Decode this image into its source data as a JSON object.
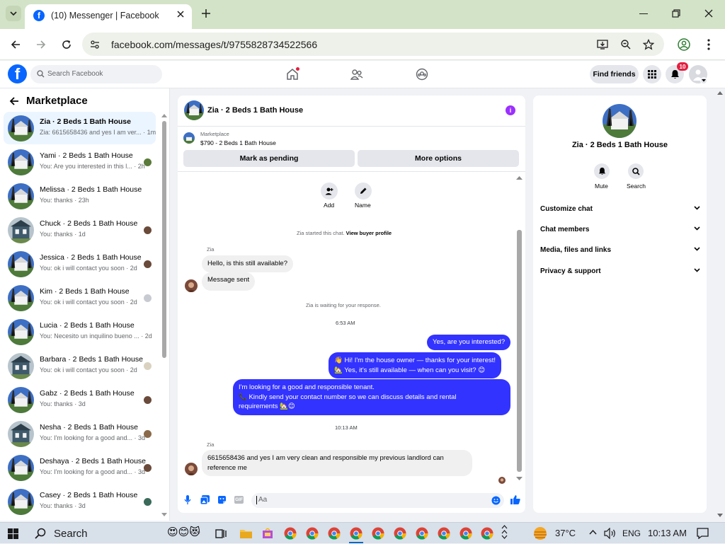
{
  "browser": {
    "tab_title": "(10) Messenger | Facebook",
    "url": "facebook.com/messages/t/9755828734522566"
  },
  "header": {
    "search_placeholder": "Search Facebook",
    "find_friends": "Find friends",
    "notif_count": "10"
  },
  "sidebar": {
    "title": "Marketplace",
    "conversations": [
      {
        "name": "Zia · 2 Beds 1 Bath House",
        "preview": "Zia: 6615658436 and yes I am ver...",
        "time": "· 1m"
      },
      {
        "name": "Yami · 2 Beds 1 Bath House",
        "preview": "You: Are you interested in this l...",
        "time": "· 2h"
      },
      {
        "name": "Melissa · 2 Beds 1 Bath House",
        "preview": "You: thanks",
        "time": "· 23h"
      },
      {
        "name": "Chuck · 2 Beds 1 Bath House",
        "preview": "You: thanks",
        "time": "· 1d"
      },
      {
        "name": "Jessica · 2 Beds 1 Bath House",
        "preview": "You: ok i will contact you soon",
        "time": "· 2d"
      },
      {
        "name": "Kim · 2 Beds 1 Bath House",
        "preview": "You: ok i will contact you soon",
        "time": "· 2d"
      },
      {
        "name": "Lucia · 2 Beds 1 Bath House",
        "preview": "You: Necesito un inquilino bueno ...",
        "time": "· 2d"
      },
      {
        "name": "Barbara · 2 Beds 1 Bath House",
        "preview": "You: ok i will contact you soon",
        "time": "· 2d"
      },
      {
        "name": "Gabz · 2 Beds 1 Bath House",
        "preview": "You: thanks",
        "time": "· 3d"
      },
      {
        "name": "Nesha · 2 Beds 1 Bath House",
        "preview": "You: I'm looking for a good and...",
        "time": "· 3d"
      },
      {
        "name": "Deshaya · 2 Beds 1 Bath House",
        "preview": "You: I'm looking for a good and...",
        "time": "· 3d"
      },
      {
        "name": "Casey · 2 Beds 1 Bath House",
        "preview": "You: thanks",
        "time": "· 3d"
      }
    ]
  },
  "chat": {
    "title": "Zia · 2 Beds 1 Bath House",
    "listing_label": "Marketplace",
    "listing_text": "$790 - 2 Beds 1 Bath House",
    "mark_pending": "Mark as pending",
    "more_options": "More options",
    "add_label": "Add",
    "name_label": "Name",
    "started_text": "Zia started this chat.",
    "view_profile": "View buyer profile",
    "sender_name": "Zia",
    "msg1": "Hello, is this still available?",
    "msg2": "Message sent",
    "waiting_text": "Zia is waiting for your response.",
    "time1": "6:53 AM",
    "out1": "Yes, are you interested?",
    "out2_line1": "👋 Hi! I'm the house owner — thanks for your interest!",
    "out2_line2": "🏡 Yes, it's still available — when can you visit? 😊",
    "out3_line1": "I'm looking for a good and responsible tenant.",
    "out3_line2": "📞 Kindly send your contact number so we can discuss details and rental",
    "out3_line3": "requirements 🏡😊",
    "time2": "10:13 AM",
    "sender_name2": "Zia",
    "msg3_line1": "6615658436 and yes I am very clean and responsible my previous landlord can",
    "msg3_line2": "reference me",
    "composer_placeholder": "Aa"
  },
  "details": {
    "name": "Zia · 2 Beds 1 Bath House",
    "mute": "Mute",
    "search": "Search",
    "sections": [
      "Customize chat",
      "Chat members",
      "Media, files and links",
      "Privacy & support"
    ]
  },
  "taskbar": {
    "search": "Search",
    "weather": "37°C",
    "lang": "ENG",
    "time": "10:13 AM"
  },
  "colors": {
    "accent": "#3333ff",
    "fb_blue": "#0866ff",
    "purple": "#9b30ff",
    "notif_red": "#e41e3f"
  }
}
